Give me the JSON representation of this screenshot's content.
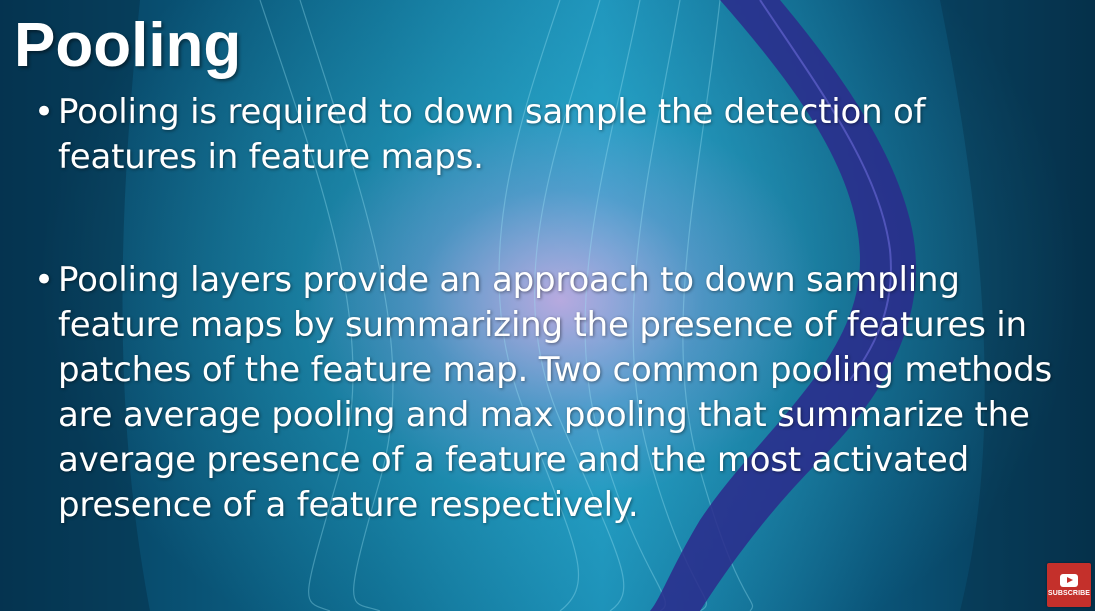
{
  "slide": {
    "title": "Pooling",
    "bullets": [
      {
        "symbol": "•",
        "text": "Pooling is required to down sample the detection of features in feature maps."
      },
      {
        "symbol": "•",
        "text": "Pooling layers provide an approach to down sampling feature maps by summarizing the presence of features in patches of the feature map. Two common pooling methods are average pooling and max pooling that summarize the average presence of a feature and the most activated presence of a feature respectively."
      }
    ]
  },
  "subscribe": {
    "label": "SUBSCRIBE",
    "icon": "youtube-play-icon",
    "color": "#c4302b"
  },
  "colors": {
    "text": "#ffffff",
    "background_dark": "#053a5a",
    "background_mid": "#1a8cb4",
    "glow": "#e6aae6",
    "ribbon_purple": "#2a2a8a"
  }
}
